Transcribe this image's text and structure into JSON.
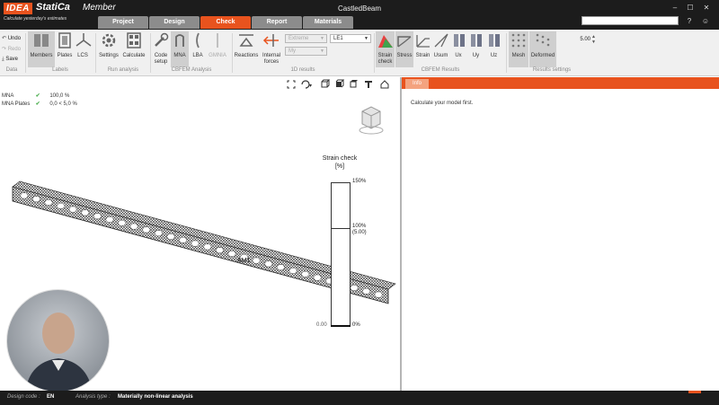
{
  "app": {
    "logo_brand": "IDEA",
    "logo_product": "StatiCa",
    "logo_edition": "Member",
    "tagline": "Calculate yesterday's estimates",
    "window_title": "CastledBeam"
  },
  "tabs": [
    {
      "label": "Project"
    },
    {
      "label": "Design"
    },
    {
      "label": "Check"
    },
    {
      "label": "Report"
    },
    {
      "label": "Materials"
    }
  ],
  "window_buttons": {
    "minimize": "–",
    "maximize": "☐",
    "close": "✕",
    "help": "?",
    "feedback": "☺"
  },
  "ribbon": {
    "data_group": {
      "undo": "Undo",
      "redo": "Redo",
      "save": "Save",
      "label": "Data"
    },
    "labels_group": {
      "members": "Members",
      "plates": "Plates",
      "lcs": "LCS",
      "label": "Labels"
    },
    "run_group": {
      "settings": "Settings",
      "calculate": "Calculate",
      "label": "Run analysis"
    },
    "cbfem_group": {
      "code_setup": "Code setup",
      "mna": "MNA",
      "lba": "LBA",
      "gmnia": "GMNIA",
      "label": "CBFEM Analysis"
    },
    "results_1d": {
      "reactions": "Reactions",
      "internal_forces": "Internal forces",
      "extreme": "Extreme",
      "my": "My",
      "le1": "LE1",
      "label": "1D results"
    },
    "cbfem_results": {
      "strain_check": "Strain check",
      "stress": "Stress",
      "strain": "Strain",
      "usum": "Usum",
      "ux": "Ux",
      "uy": "Uy",
      "uz": "Uz",
      "label": "CBFEM Results"
    },
    "results_settings": {
      "mesh": "Mesh",
      "deformed": "Deformed",
      "scale_value": "5.00",
      "label": "Results settings"
    }
  },
  "checks": [
    {
      "name": "MNA",
      "value": "100,0 %"
    },
    {
      "name": "MNA Plates",
      "value": "0,0 < 5,0 %"
    }
  ],
  "legend": {
    "title": "Strain check",
    "unit": "[%]",
    "top": "150%",
    "mid": "100%",
    "mid_sub": "(5.00)",
    "bottom": "0%",
    "bottom_left": "0.00"
  },
  "member_label": "AM1",
  "info": {
    "tab": "Info",
    "message": "Calculate your model first."
  },
  "status": {
    "design_code_label": "Design code :",
    "design_code": "EN",
    "analysis_type_label": "Analysis type :",
    "analysis_type": "Materially non-linear analysis"
  },
  "colors": {
    "accent": "#e8531e",
    "titlebar": "#1c1c1c",
    "ribbon": "#f0f0f0",
    "check_ok": "#4caf50"
  }
}
